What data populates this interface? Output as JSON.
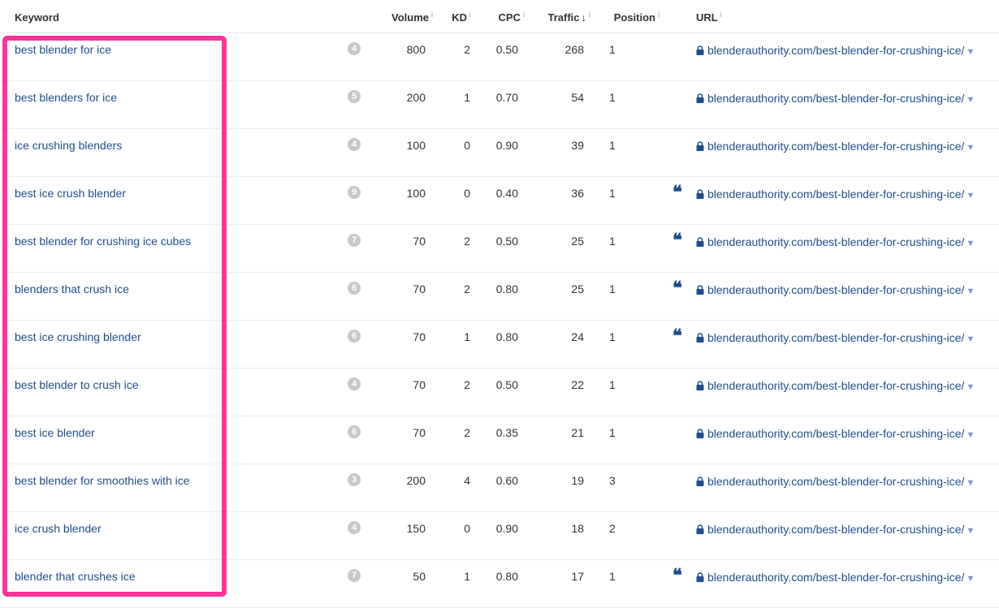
{
  "columns": {
    "keyword": "Keyword",
    "volume": "Volume",
    "kd": "KD",
    "cpc": "CPC",
    "traffic": "Traffic",
    "position": "Position",
    "url": "URL",
    "info_glyph": "i",
    "sort_arrow": "↓"
  },
  "colors": {
    "link": "#1f4e8c",
    "highlight_border": "#ff3399",
    "badge_gray": "#c8c8c8"
  },
  "icons": {
    "lock": "lock-icon",
    "featured_snippet": "quote-icon",
    "dropdown": "caret-down-icon"
  },
  "rows": [
    {
      "keyword": "best blender for ice",
      "kd_score": "4",
      "volume": "800",
      "kd": "2",
      "cpc": "0.50",
      "traffic": "268",
      "position": "1",
      "snippet": "",
      "url": "blenderauthority.com/best-blender-for-crushing-ice/"
    },
    {
      "keyword": "best blenders for ice",
      "kd_score": "5",
      "volume": "200",
      "kd": "1",
      "cpc": "0.70",
      "traffic": "54",
      "position": "1",
      "snippet": "",
      "url": "blenderauthority.com/best-blender-for-crushing-ice/"
    },
    {
      "keyword": "ice crushing blenders",
      "kd_score": "4",
      "volume": "100",
      "kd": "0",
      "cpc": "0.90",
      "traffic": "39",
      "position": "1",
      "snippet": "",
      "url": "blenderauthority.com/best-blender-for-crushing-ice/"
    },
    {
      "keyword": "best ice crush blender",
      "kd_score": "9",
      "volume": "100",
      "kd": "0",
      "cpc": "0.40",
      "traffic": "36",
      "position": "1",
      "snippet": "❝",
      "url": "blenderauthority.com/best-blender-for-crushing-ice/"
    },
    {
      "keyword": "best blender for crushing ice cubes",
      "kd_score": "7",
      "volume": "70",
      "kd": "2",
      "cpc": "0.50",
      "traffic": "25",
      "position": "1",
      "snippet": "❝",
      "url": "blenderauthority.com/best-blender-for-crushing-ice/"
    },
    {
      "keyword": "blenders that crush ice",
      "kd_score": "6",
      "volume": "70",
      "kd": "2",
      "cpc": "0.80",
      "traffic": "25",
      "position": "1",
      "snippet": "❝",
      "url": "blenderauthority.com/best-blender-for-crushing-ice/"
    },
    {
      "keyword": "best ice crushing blender",
      "kd_score": "6",
      "volume": "70",
      "kd": "1",
      "cpc": "0.80",
      "traffic": "24",
      "position": "1",
      "snippet": "❝",
      "url": "blenderauthority.com/best-blender-for-crushing-ice/"
    },
    {
      "keyword": "best blender to crush ice",
      "kd_score": "4",
      "volume": "70",
      "kd": "2",
      "cpc": "0.50",
      "traffic": "22",
      "position": "1",
      "snippet": "",
      "url": "blenderauthority.com/best-blender-for-crushing-ice/"
    },
    {
      "keyword": "best ice blender",
      "kd_score": "6",
      "volume": "70",
      "kd": "2",
      "cpc": "0.35",
      "traffic": "21",
      "position": "1",
      "snippet": "",
      "url": "blenderauthority.com/best-blender-for-crushing-ice/"
    },
    {
      "keyword": "best blender for smoothies with ice",
      "kd_score": "3",
      "volume": "200",
      "kd": "4",
      "cpc": "0.60",
      "traffic": "19",
      "position": "3",
      "snippet": "",
      "url": "blenderauthority.com/best-blender-for-crushing-ice/"
    },
    {
      "keyword": "ice crush blender",
      "kd_score": "4",
      "volume": "150",
      "kd": "0",
      "cpc": "0.90",
      "traffic": "18",
      "position": "2",
      "snippet": "",
      "url": "blenderauthority.com/best-blender-for-crushing-ice/"
    },
    {
      "keyword": "blender that crushes ice",
      "kd_score": "7",
      "volume": "50",
      "kd": "1",
      "cpc": "0.80",
      "traffic": "17",
      "position": "1",
      "snippet": "❝",
      "url": "blenderauthority.com/best-blender-for-crushing-ice/"
    }
  ]
}
